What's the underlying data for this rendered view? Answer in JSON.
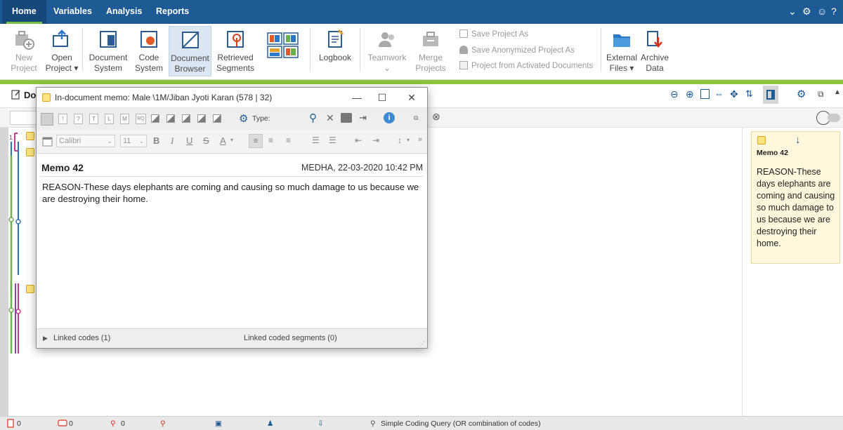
{
  "menubar": {
    "tabs": [
      {
        "label": "Home",
        "active": true
      },
      {
        "label": "Variables",
        "active": false
      },
      {
        "label": "Analysis",
        "active": false
      },
      {
        "label": "Reports",
        "active": false
      }
    ]
  },
  "ribbon": {
    "new_project": [
      "New",
      "Project"
    ],
    "open_project": [
      "Open",
      "Project ▾"
    ],
    "document_system": [
      "Document",
      "System"
    ],
    "code_system": [
      "Code",
      "System"
    ],
    "document_browser": [
      "Document",
      "Browser"
    ],
    "retrieved_segments": [
      "Retrieved",
      "Segments"
    ],
    "logbook": "Logbook",
    "teamwork": [
      "Teamwork",
      "⌄"
    ],
    "merge_projects": [
      "Merge",
      "Projects"
    ],
    "save_project_as": "Save Project As",
    "save_anonymized": "Save Anonymized Project As",
    "project_from_activated": "Project from Activated Documents",
    "external_files": [
      "External",
      "Files ▾"
    ],
    "archive_data": [
      "Archive",
      "Data"
    ]
  },
  "browser": {
    "title_fragment": "Do"
  },
  "memo_window": {
    "title": "In-document memo: Male \\1M/Jiban Jyoti Karan (578 | 32)",
    "type_label": "Type:",
    "font_name": "Calibri",
    "font_size": "11",
    "memo_title": "Memo 42",
    "memo_meta": "MEDHA, 22-03-2020 10:42 PM",
    "memo_text": "REASON-These days elephants are coming and causing so much damage to us because we are destroying their home.",
    "linked_codes": "Linked codes (1)",
    "linked_segments": "Linked coded segments (0)",
    "type_buttons": [
      "!",
      "?",
      "T",
      "L",
      "M",
      "RQ"
    ]
  },
  "memo_card": {
    "title": "Memo 42",
    "text": "REASON-These days elephants are coming and causing so much damage to us because we are destroying their home."
  },
  "statusbar": {
    "doc_count": "0",
    "seg_count": "0",
    "code_count": "0",
    "query_label": "Simple Coding Query (OR combination of codes)"
  },
  "colors": {
    "menubar": "#1e5a94",
    "accent_green": "#8cc63f",
    "memo_yellow": "#fde47f",
    "code_magenta": "#c0398b",
    "code_green": "#6ab04c",
    "code_blue": "#2f6fb3",
    "code_purple": "#8e44ad"
  }
}
